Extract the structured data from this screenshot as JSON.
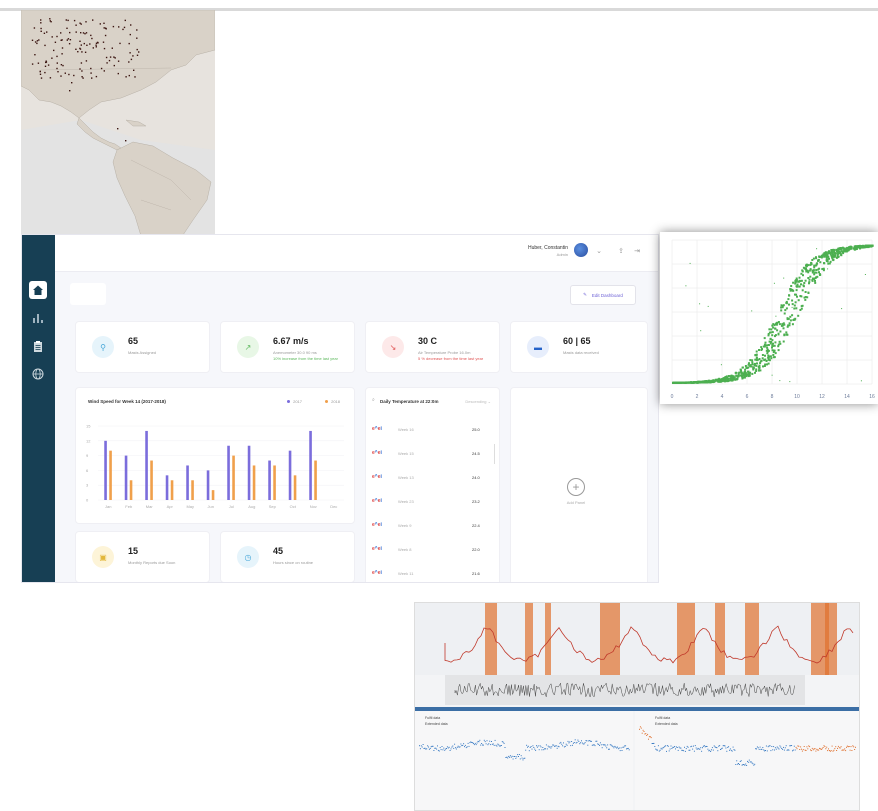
{
  "dashboard": {
    "user": {
      "name": "Huber, Constantin",
      "subtitle": "Admin"
    },
    "edit_label": "Edit Dashboard",
    "kpis": [
      {
        "value": "65",
        "label": "Masts Assigned",
        "sub": ""
      },
      {
        "value": "6.67 m/s",
        "label": "Anemometer 30.0 90 ms",
        "sub": "10% increase from the time last year"
      },
      {
        "value": "30 C",
        "label": "Air Temperature Probe 16.0m",
        "sub": "5 % decrease from the time last year"
      },
      {
        "value": "60 | 65",
        "label": "Masts data received",
        "sub": ""
      },
      {
        "value": "15",
        "label": "Monthly Reports due Soon",
        "sub": ""
      },
      {
        "value": "45",
        "label": "Hours since on routine",
        "sub": ""
      }
    ],
    "wind_panel": {
      "title": "Wind Speed for Week 14 (2017-2018)",
      "legend": [
        "2017",
        "2018"
      ],
      "colors": [
        "#7b6ddc",
        "#f0a04b"
      ],
      "months": [
        "Jan",
        "Feb",
        "Mar",
        "Apr",
        "May",
        "Jun",
        "Jul",
        "Aug",
        "Sep",
        "Oct",
        "Nov",
        "Dec"
      ],
      "series_2017": [
        12,
        9,
        14,
        5,
        7,
        6,
        11,
        11,
        8,
        10,
        14,
        0
      ],
      "series_2018": [
        10,
        4,
        8,
        4,
        4,
        2,
        9,
        7,
        7,
        5,
        8,
        0
      ],
      "y_ticks": [
        "15",
        "12",
        "9",
        "6",
        "3",
        "0"
      ]
    },
    "temp_panel": {
      "title": "Daily Temperature at 22:0m",
      "sort": "Descending",
      "rows": [
        {
          "week": "Week 16",
          "value": "25.0"
        },
        {
          "week": "Week 15",
          "value": "24.5"
        },
        {
          "week": "Week 13",
          "value": "24.0"
        },
        {
          "week": "Week 23",
          "value": "23.2"
        },
        {
          "week": "Week 9",
          "value": "22.4"
        },
        {
          "week": "Week 8",
          "value": "22.0"
        },
        {
          "week": "Week 11",
          "value": "21.6"
        }
      ]
    },
    "add_panel_label": "Add Panel"
  },
  "scatter": {
    "x_ticks": [
      "0",
      "2",
      "4",
      "6",
      "8",
      "10",
      "12",
      "14",
      "16"
    ],
    "color": "#4caf50"
  },
  "timeseries": {
    "legend_left": [
      "Fulfil data",
      "Extended data"
    ],
    "legend_right": [
      "Fulfil data",
      "Extended data"
    ],
    "colors": {
      "blue": "#3b7cc4",
      "orange": "#e0702e",
      "red": "#c0392b"
    }
  },
  "icons": [
    "home-icon",
    "bar-chart-icon",
    "clipboard-icon",
    "globe-icon",
    "location-icon",
    "trend-icon",
    "thermometer-icon",
    "folder-icon",
    "calendar-icon",
    "clock-icon",
    "pencil-icon",
    "plus-icon",
    "search-icon",
    "share-icon",
    "logout-icon"
  ]
}
